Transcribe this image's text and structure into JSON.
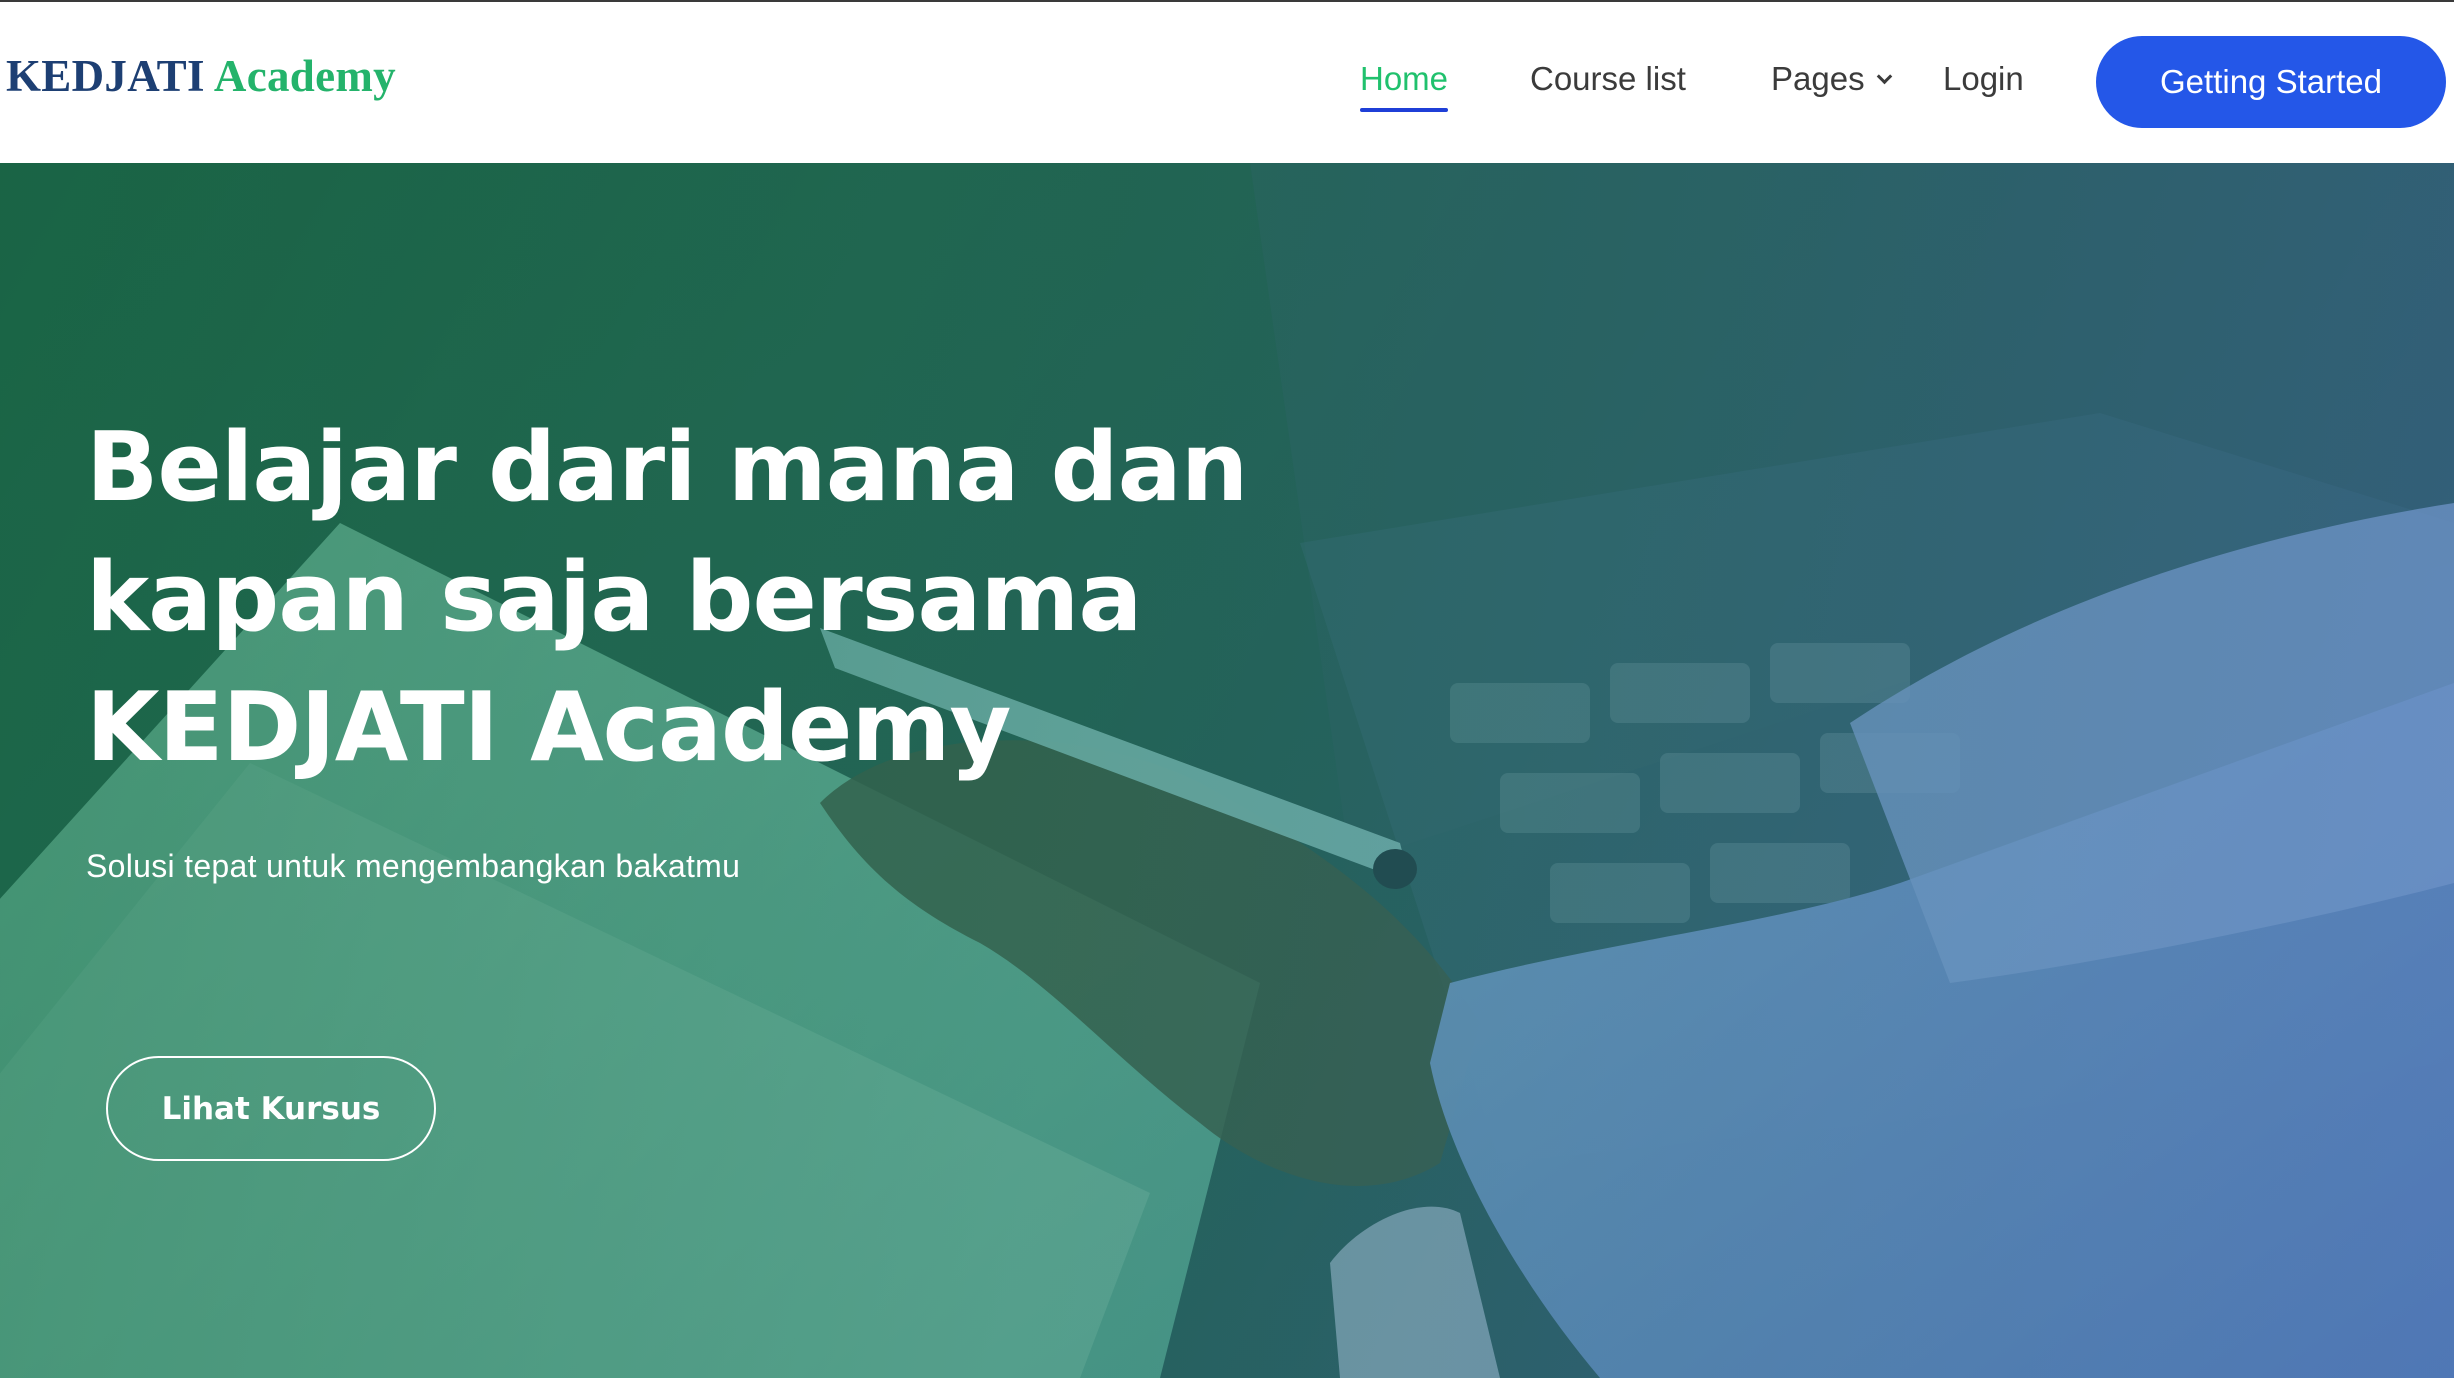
{
  "brand": {
    "name_part1": "KEDJATI",
    "name_part2": "Academy",
    "color_primary": "#1d3f73",
    "color_accent": "#24b36b"
  },
  "nav": {
    "items": [
      {
        "label": "Home",
        "active": true
      },
      {
        "label": "Course list",
        "active": false
      },
      {
        "label": "Pages",
        "active": false,
        "has_dropdown": true
      },
      {
        "label": "Login",
        "active": false
      }
    ],
    "cta_label": "Getting Started",
    "cta_color": "#2457e8",
    "active_color": "#20c16d"
  },
  "hero": {
    "title_lines": [
      "Belajar dari mana dan",
      "kapan saja bersama",
      "KEDJATI Academy"
    ],
    "subtitle": "Solusi tepat untuk mengembangkan bakatmu",
    "button_label": "Lihat Kursus",
    "background_description_icon": "student-notebook-photo"
  }
}
